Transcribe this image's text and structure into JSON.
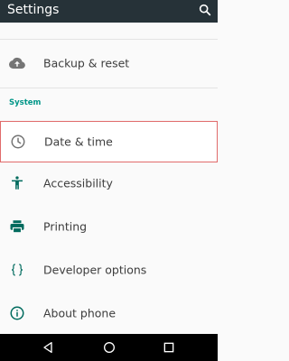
{
  "appbar": {
    "title": "Settings",
    "search_icon": "search-icon"
  },
  "items": [
    {
      "label": "Backup & reset",
      "icon": "cloud-upload-icon"
    },
    {
      "label": "Date & time",
      "icon": "clock-icon",
      "selected": true
    },
    {
      "label": "Accessibility",
      "icon": "accessibility-icon"
    },
    {
      "label": "Printing",
      "icon": "printer-icon"
    },
    {
      "label": "Developer options",
      "icon": "code-braces-icon"
    },
    {
      "label": "About phone",
      "icon": "info-icon"
    }
  ],
  "section": {
    "system_label": "System"
  },
  "navbar": {
    "back": "back-icon",
    "home": "home-icon",
    "recents": "recents-icon"
  },
  "colors": {
    "appbar": "#263238",
    "accent": "#009688",
    "selection_border": "#e06b6b",
    "icon": "#757575"
  }
}
